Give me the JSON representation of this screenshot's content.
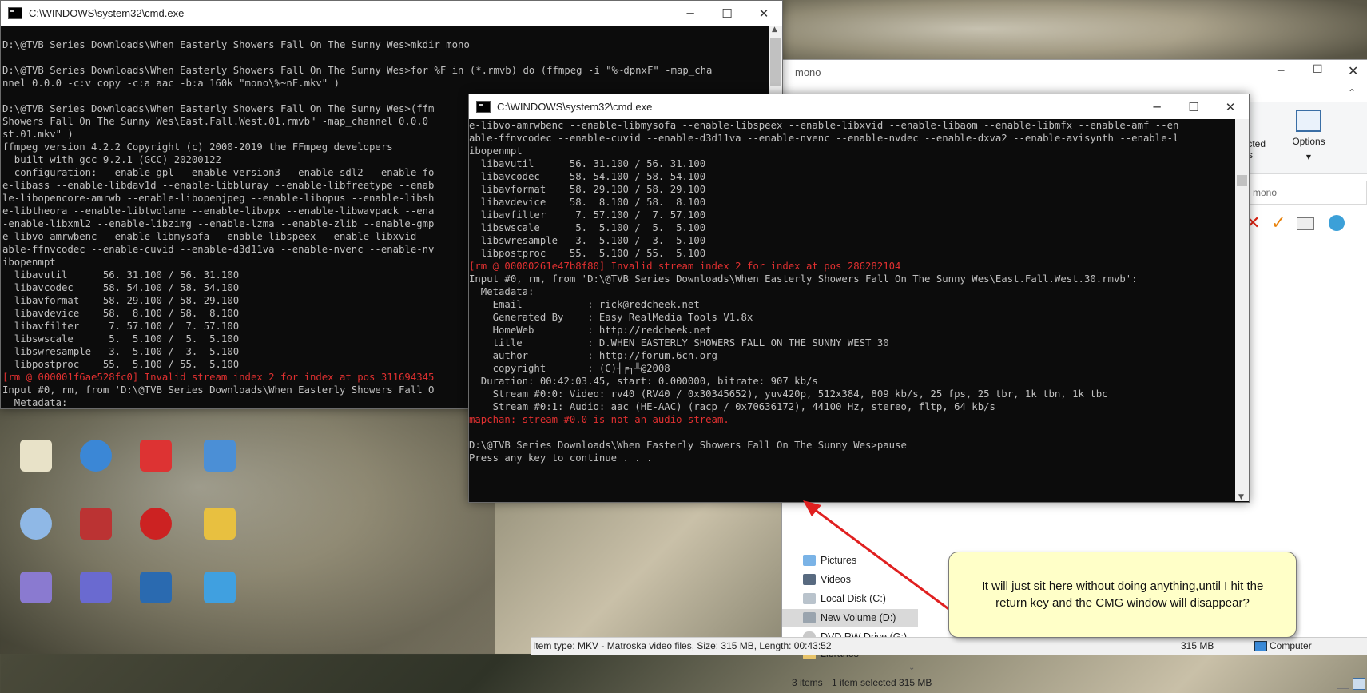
{
  "cmd_back": {
    "title": "C:\\WINDOWS\\system32\\cmd.exe",
    "lines": [
      {
        "t": "",
        "c": ""
      },
      {
        "t": "D:\\@TVB Series Downloads\\When Easterly Showers Fall On The Sunny Wes>mkdir mono",
        "c": ""
      },
      {
        "t": "",
        "c": ""
      },
      {
        "t": "D:\\@TVB Series Downloads\\When Easterly Showers Fall On The Sunny Wes>for %F in (*.rmvb) do (ffmpeg -i \"%~dpnxF\" -map_cha",
        "c": ""
      },
      {
        "t": "nnel 0.0.0 -c:v copy -c:a aac -b:a 160k \"mono\\%~nF.mkv\" )",
        "c": ""
      },
      {
        "t": "",
        "c": ""
      },
      {
        "t": "D:\\@TVB Series Downloads\\When Easterly Showers Fall On The Sunny Wes>(ffm",
        "c": ""
      },
      {
        "t": "Showers Fall On The Sunny Wes\\East.Fall.West.01.rmvb\" -map_channel 0.0.0",
        "c": ""
      },
      {
        "t": "st.01.mkv\" )",
        "c": ""
      },
      {
        "t": "ffmpeg version 4.2.2 Copyright (c) 2000-2019 the FFmpeg developers",
        "c": ""
      },
      {
        "t": "  built with gcc 9.2.1 (GCC) 20200122",
        "c": ""
      },
      {
        "t": "  configuration: --enable-gpl --enable-version3 --enable-sdl2 --enable-fo",
        "c": ""
      },
      {
        "t": "e-libass --enable-libdav1d --enable-libbluray --enable-libfreetype --enab",
        "c": ""
      },
      {
        "t": "le-libopencore-amrwb --enable-libopenjpeg --enable-libopus --enable-libsh",
        "c": ""
      },
      {
        "t": "e-libtheora --enable-libtwolame --enable-libvpx --enable-libwavpack --ena",
        "c": ""
      },
      {
        "t": "-enable-libxml2 --enable-libzimg --enable-lzma --enable-zlib --enable-gmp",
        "c": ""
      },
      {
        "t": "e-libvo-amrwbenc --enable-libmysofa --enable-libspeex --enable-libxvid --",
        "c": ""
      },
      {
        "t": "able-ffnvcodec --enable-cuvid --enable-d3d11va --enable-nvenc --enable-nv",
        "c": ""
      },
      {
        "t": "ibopenmpt",
        "c": ""
      },
      {
        "t": "  libavutil      56. 31.100 / 56. 31.100",
        "c": ""
      },
      {
        "t": "  libavcodec     58. 54.100 / 58. 54.100",
        "c": ""
      },
      {
        "t": "  libavformat    58. 29.100 / 58. 29.100",
        "c": ""
      },
      {
        "t": "  libavdevice    58.  8.100 / 58.  8.100",
        "c": ""
      },
      {
        "t": "  libavfilter     7. 57.100 /  7. 57.100",
        "c": ""
      },
      {
        "t": "  libswscale      5.  5.100 /  5.  5.100",
        "c": ""
      },
      {
        "t": "  libswresample   3.  5.100 /  3.  5.100",
        "c": ""
      },
      {
        "t": "  libpostproc    55.  5.100 / 55.  5.100",
        "c": ""
      },
      {
        "t": "[rm @ 000001f6ae528fc0] Invalid stream index 2 for index at pos 311694345",
        "c": "red"
      },
      {
        "t": "Input #0, rm, from 'D:\\@TVB Series Downloads\\When Easterly Showers Fall O",
        "c": ""
      },
      {
        "t": "  Metadata:",
        "c": ""
      }
    ]
  },
  "cmd_front": {
    "title": "C:\\WINDOWS\\system32\\cmd.exe",
    "lines": [
      {
        "t": "e-libvo-amrwbenc --enable-libmysofa --enable-libspeex --enable-libxvid --enable-libaom --enable-libmfx --enable-amf --en",
        "c": ""
      },
      {
        "t": "able-ffnvcodec --enable-cuvid --enable-d3d11va --enable-nvenc --enable-nvdec --enable-dxva2 --enable-avisynth --enable-l",
        "c": ""
      },
      {
        "t": "ibopenmpt",
        "c": ""
      },
      {
        "t": "  libavutil      56. 31.100 / 56. 31.100",
        "c": ""
      },
      {
        "t": "  libavcodec     58. 54.100 / 58. 54.100",
        "c": ""
      },
      {
        "t": "  libavformat    58. 29.100 / 58. 29.100",
        "c": ""
      },
      {
        "t": "  libavdevice    58.  8.100 / 58.  8.100",
        "c": ""
      },
      {
        "t": "  libavfilter     7. 57.100 /  7. 57.100",
        "c": ""
      },
      {
        "t": "  libswscale      5.  5.100 /  5.  5.100",
        "c": ""
      },
      {
        "t": "  libswresample   3.  5.100 /  3.  5.100",
        "c": ""
      },
      {
        "t": "  libpostproc    55.  5.100 / 55.  5.100",
        "c": ""
      },
      {
        "t": "[rm @ 00000261e47b8f80] Invalid stream index 2 for index at pos 286282104",
        "c": "red"
      },
      {
        "t": "Input #0, rm, from 'D:\\@TVB Series Downloads\\When Easterly Showers Fall On The Sunny Wes\\East.Fall.West.30.rmvb':",
        "c": ""
      },
      {
        "t": "  Metadata:",
        "c": ""
      },
      {
        "t": "    Email           : rick@redcheek.net",
        "c": ""
      },
      {
        "t": "    Generated By    : Easy RealMedia Tools V1.8x",
        "c": ""
      },
      {
        "t": "    HomeWeb         : http://redcheek.net",
        "c": ""
      },
      {
        "t": "    title           : D.WHEN EASTERLY SHOWERS FALL ON THE SUNNY WEST 30",
        "c": ""
      },
      {
        "t": "    author          : http://forum.6cn.org",
        "c": ""
      },
      {
        "t": "    copyright       : (C)┤╒┐╨@2008",
        "c": ""
      },
      {
        "t": "  Duration: 00:42:03.45, start: 0.000000, bitrate: 907 kb/s",
        "c": ""
      },
      {
        "t": "    Stream #0:0: Video: rv40 (RV40 / 0x30345652), yuv420p, 512x384, 809 kb/s, 25 fps, 25 tbr, 1k tbn, 1k tbc",
        "c": ""
      },
      {
        "t": "    Stream #0:1: Audio: aac (HE-AAC) (racp / 0x70636172), 44100 Hz, stereo, fltp, 64 kb/s",
        "c": ""
      },
      {
        "t": "mapchan: stream #0.0 is not an audio stream.",
        "c": "red"
      },
      {
        "t": "",
        "c": ""
      },
      {
        "t": "D:\\@TVB Series Downloads\\When Easterly Showers Fall On The Sunny Wes>pause",
        "c": ""
      },
      {
        "t": "Press any key to continue . . .",
        "c": ""
      }
    ]
  },
  "explorer": {
    "title": "mono",
    "ribbon": {
      "selected_label": "lected\nms",
      "options_label": "Options"
    },
    "search_placeholder": "rch mono",
    "nav_items": [
      {
        "label": "Pictures",
        "icon": "pictures-icon"
      },
      {
        "label": "Videos",
        "icon": "videos-icon"
      },
      {
        "label": "Local Disk (C:)",
        "icon": "local-disk-icon"
      },
      {
        "label": "New Volume (D:)",
        "icon": "drive-icon"
      },
      {
        "label": "DVD RW Drive (G:)",
        "icon": "dvd-drive-icon"
      },
      {
        "label": "Libraries",
        "icon": "libraries-icon"
      }
    ],
    "status": {
      "items": "3 items",
      "selected": "1 item selected  315 MB"
    },
    "details": {
      "info": "Item type: MKV - Matroska video files, Size: 315 MB, Length: 00:43:52",
      "size": "315 MB",
      "computer": "Computer"
    }
  },
  "callout": {
    "text": "It will just sit here without doing anything,until I hit the return key and the CMG window will disappear?"
  },
  "colors": {
    "console_bg": "#0c0c0c",
    "console_text": "#c0c0c0",
    "console_error": "#e03030",
    "callout_bg": "#ffffc8",
    "arrow": "#e02020",
    "selected_nav": "#cce8ff"
  }
}
